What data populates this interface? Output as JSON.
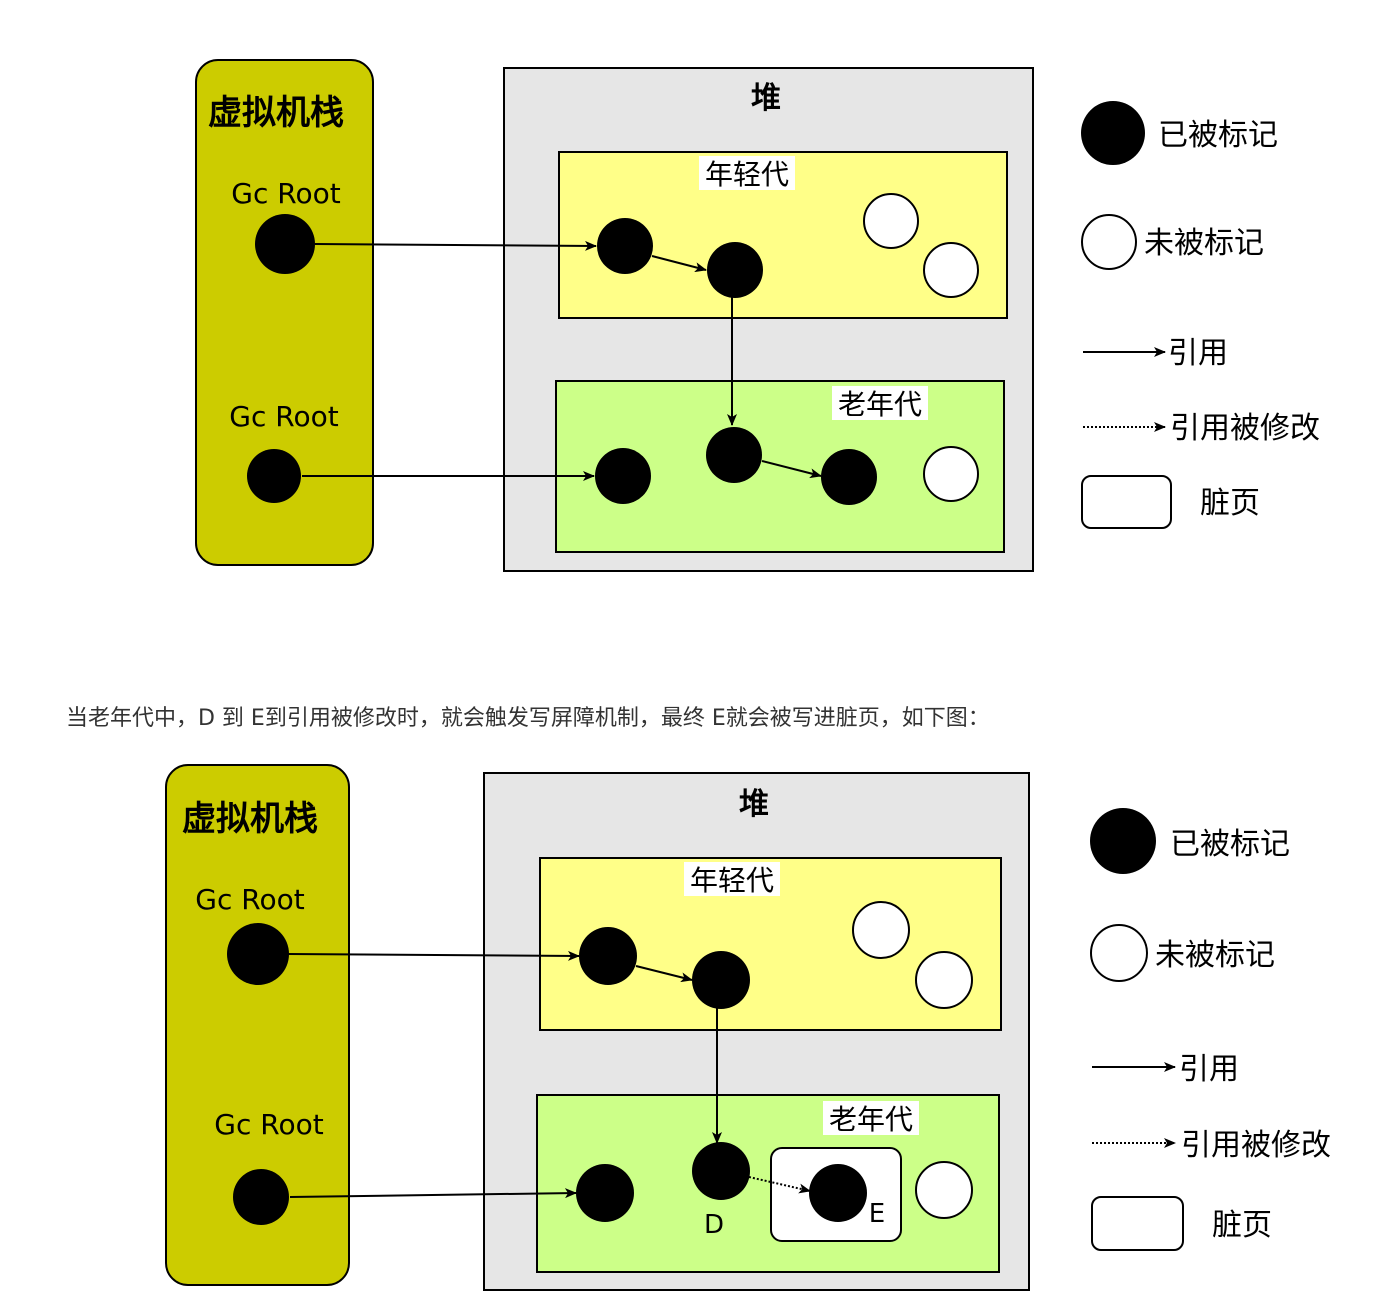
{
  "diagram1": {
    "stack_label": "虚拟机栈",
    "gc_root_1": "Gc Root",
    "gc_root_2": "Gc Root",
    "heap_label": "堆",
    "young_label": "年轻代",
    "old_label": "老年代",
    "legend": {
      "marked": "已被标记",
      "unmarked": "未被标记",
      "reference": "引用",
      "modified_reference": "引用被修改",
      "dirty_page": "脏页"
    }
  },
  "caption": "当老年代中，D 到 E到引用被修改时，就会触发写屏障机制，最终 E就会被写进脏页，如下图：",
  "diagram2": {
    "stack_label": "虚拟机栈",
    "gc_root_1": "Gc Root",
    "gc_root_2": "Gc Root",
    "heap_label": "堆",
    "young_label": "年轻代",
    "old_label": "老年代",
    "node_d_label": "D",
    "node_e_label": "E",
    "legend": {
      "marked": "已被标记",
      "unmarked": "未被标记",
      "reference": "引用",
      "modified_reference": "引用被修改",
      "dirty_page": "脏页"
    }
  },
  "colors": {
    "stack_fill": "#cccc00",
    "heap_fill": "#e6e6e6",
    "young_fill": "#ffff88",
    "old_fill": "#ccff88",
    "node_marked": "#000000",
    "node_unmarked": "#ffffff"
  }
}
